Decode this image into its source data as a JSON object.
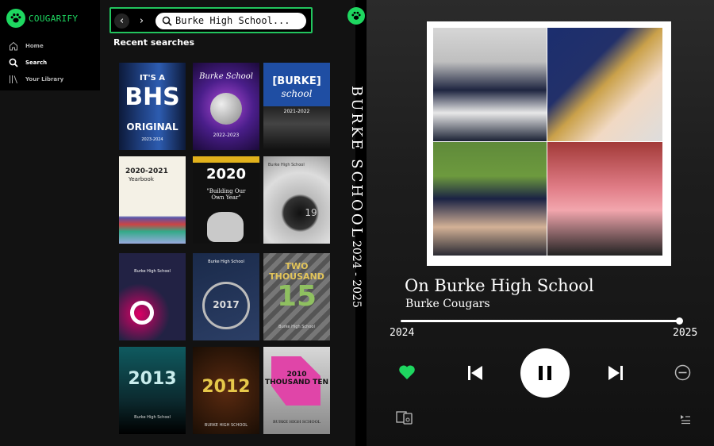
{
  "app": {
    "name": "COUGARIFY",
    "accent": "#1ed760"
  },
  "sidebar": {
    "items": [
      {
        "label": "Home",
        "icon": "home-icon"
      },
      {
        "label": "Search",
        "icon": "search-icon",
        "active": true
      },
      {
        "label": "Your Library",
        "icon": "library-icon"
      }
    ]
  },
  "search": {
    "query": "Burke High School...",
    "back": "‹",
    "forward": "›"
  },
  "recent": {
    "title": "Recent searches",
    "covers": [
      {
        "lines": [
          "IT'S A",
          "BHS",
          "ORIGINAL"
        ],
        "year": "2023-2024"
      },
      {
        "lines": [
          "Burke School"
        ],
        "year": "2022-2023"
      },
      {
        "lines": [
          "[BURKE]",
          "school"
        ],
        "year": "2021-2022"
      },
      {
        "lines": [
          "2020-2021",
          "Yearbook"
        ],
        "year": ""
      },
      {
        "lines": [
          "2020",
          "\"Building Our Own Year\""
        ],
        "year": ""
      },
      {
        "lines": [
          "Burke High School"
        ],
        "year": "19"
      },
      {
        "lines": [
          "Burke High School"
        ],
        "year": ""
      },
      {
        "lines": [
          "Burke High School",
          "2017"
        ],
        "year": ""
      },
      {
        "lines": [
          "TWO THOUSAND",
          "15"
        ],
        "year": "Burke High School"
      },
      {
        "lines": [
          "2013"
        ],
        "year": "Burke High School"
      },
      {
        "lines": [
          "2012"
        ],
        "year": "BURKE HIGH SCHOOL"
      },
      {
        "lines": [
          "2010 THOUSAND TEN"
        ],
        "year": "BURKE HIGH SCHOOL"
      }
    ]
  },
  "sideText": {
    "title": "BURKE SCHOOL",
    "years": "2024 - 2025"
  },
  "nowPlaying": {
    "song": "On Burke High School",
    "artist": "Burke Cougars",
    "timeStart": "2024",
    "timeEnd": "2025",
    "progress": 1.0,
    "liked": true,
    "state": "playing"
  },
  "icons": [
    "heart-icon",
    "previous-icon",
    "pause-icon",
    "next-icon",
    "remove-icon",
    "devices-icon",
    "queue-icon"
  ]
}
